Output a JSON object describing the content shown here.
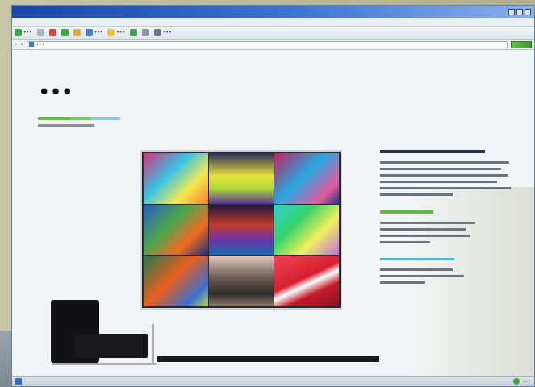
{
  "window": {
    "title": "",
    "controls": [
      "minimize",
      "maximize",
      "close"
    ]
  },
  "menubar": {
    "items": []
  },
  "toolbar": {
    "buttons": [
      {
        "icon": "back-arrow-icon",
        "label": "•••",
        "color": "#3fa34d"
      },
      {
        "icon": "forward-arrow-icon",
        "label": "",
        "color": "#a7b3bd"
      },
      {
        "icon": "stop-icon",
        "label": "",
        "color": "#d9433a"
      },
      {
        "icon": "refresh-icon",
        "label": "",
        "color": "#3fa34d"
      },
      {
        "icon": "home-icon",
        "label": "",
        "color": "#e2a93b"
      },
      {
        "icon": "search-icon",
        "label": "•••",
        "color": "#4a7cc4"
      },
      {
        "icon": "favorites-icon",
        "label": "•••",
        "color": "#f2c230"
      },
      {
        "icon": "history-icon",
        "label": "",
        "color": "#3fa34d"
      },
      {
        "icon": "mail-icon",
        "label": "",
        "color": "#8a97a3"
      },
      {
        "icon": "print-icon",
        "label": "•••",
        "color": "#6c7a88"
      }
    ]
  },
  "addressbar": {
    "label": "•••",
    "url": "•••"
  },
  "page": {
    "logo": "•••",
    "nav": [
      "",
      "",
      ""
    ]
  },
  "statusbar": {
    "text": "",
    "zone": "•••"
  },
  "colors": {
    "accent_green": "#5bbd3c",
    "accent_cyan": "#49b9d6",
    "titlebar": "#1a44a8"
  }
}
